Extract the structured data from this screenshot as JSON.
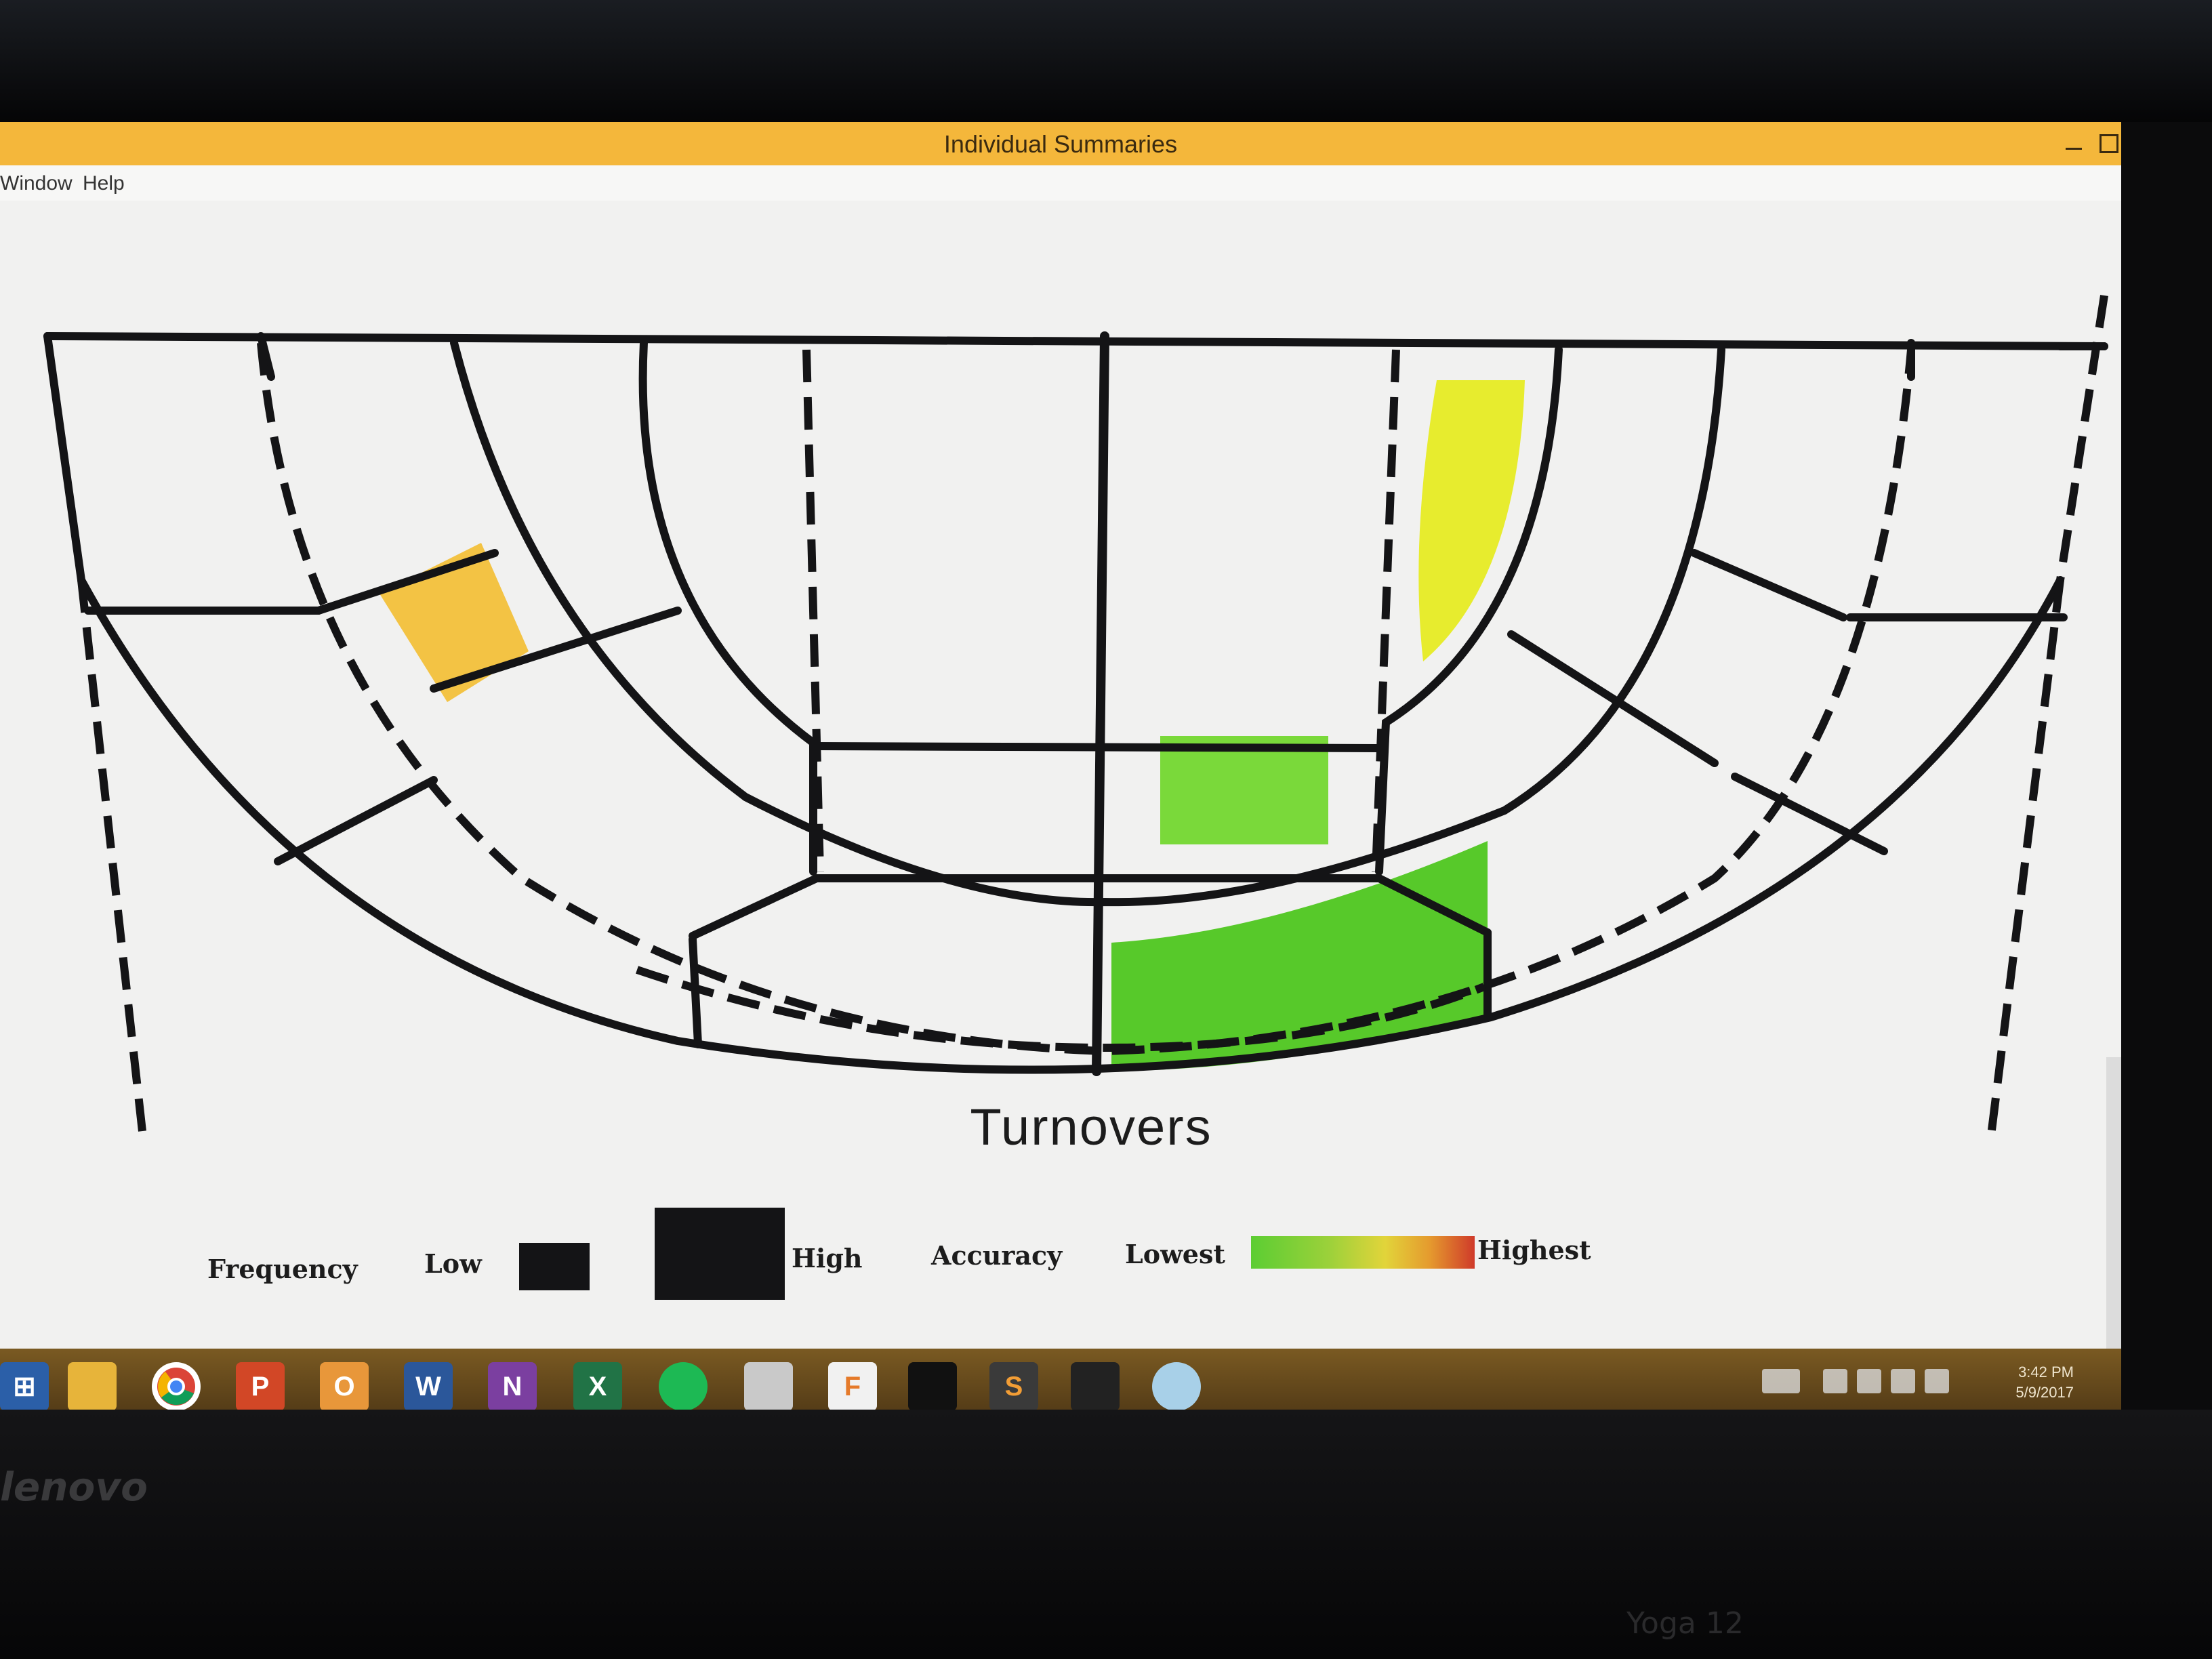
{
  "window": {
    "title": "Individual Summaries"
  },
  "menu": {
    "items": [
      "Window",
      "Help"
    ]
  },
  "chart": {
    "title": "Turnovers",
    "legend": {
      "frequency_label": "Frequency",
      "low_label": "Low",
      "high_label": "High",
      "accuracy_label": "Accuracy",
      "lowest_label": "Lowest",
      "highest_label": "Highest"
    },
    "colors": {
      "orange_zone": "#f2c03a",
      "yellow_zone": "#e7ec2e",
      "green_zone": "#7ad93a",
      "dark_green_zone": "#57c92a",
      "lines": "#141416"
    }
  },
  "taskbar": {
    "apps": [
      {
        "name": "windows-start-icon",
        "glyph": ""
      },
      {
        "name": "file-explorer-icon",
        "glyph": ""
      },
      {
        "name": "chrome-icon",
        "glyph": ""
      },
      {
        "name": "powerpoint-icon",
        "glyph": "P"
      },
      {
        "name": "outlook-icon",
        "glyph": "O"
      },
      {
        "name": "word-icon",
        "glyph": "W"
      },
      {
        "name": "onenote-icon",
        "glyph": "N"
      },
      {
        "name": "excel-icon",
        "glyph": "X"
      },
      {
        "name": "spotify-icon",
        "glyph": ""
      },
      {
        "name": "notes-icon",
        "glyph": ""
      },
      {
        "name": "f-app-icon",
        "glyph": "F"
      },
      {
        "name": "command-prompt-icon",
        "glyph": ""
      },
      {
        "name": "sublime-text-icon",
        "glyph": "S"
      },
      {
        "name": "console-icon",
        "glyph": ""
      },
      {
        "name": "app-circle-icon",
        "glyph": ""
      }
    ],
    "clock": {
      "time": "3:42 PM",
      "date": "5/9/2017"
    }
  },
  "bezel": {
    "brand": "lenovo",
    "model": "Yoga 12"
  }
}
